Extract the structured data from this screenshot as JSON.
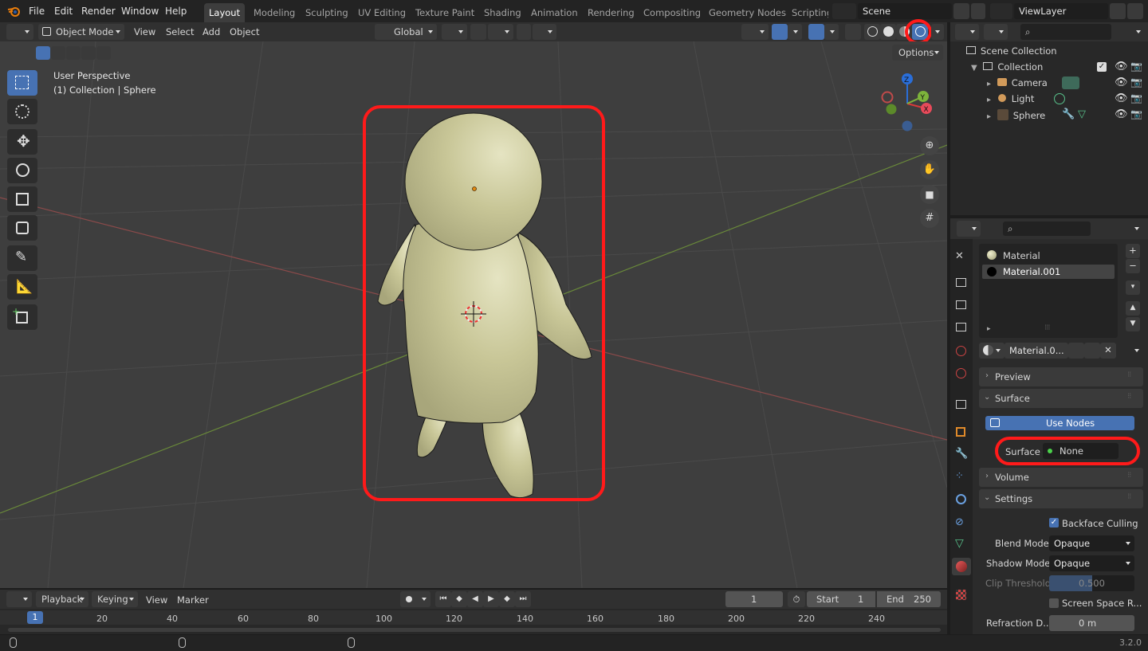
{
  "menubar": {
    "items": [
      "File",
      "Edit",
      "Render",
      "Window",
      "Help"
    ]
  },
  "workspaces": {
    "tabs": [
      "Layout",
      "Modeling",
      "Sculpting",
      "UV Editing",
      "Texture Paint",
      "Shading",
      "Animation",
      "Rendering",
      "Compositing",
      "Geometry Nodes",
      "Scripting"
    ],
    "active": "Layout"
  },
  "scene": {
    "name": "Scene"
  },
  "view_layer": {
    "name": "ViewLayer"
  },
  "viewport_header": {
    "mode": "Object Mode",
    "menus": [
      "View",
      "Select",
      "Add",
      "Object"
    ],
    "transform_orientation": "Global",
    "options_label": "Options"
  },
  "viewport": {
    "perspective_label": "User Perspective",
    "collection_label": "(1) Collection | Sphere",
    "gizmo_axes": {
      "x": "X",
      "y": "Y",
      "z": "Z"
    }
  },
  "outliner": {
    "root": "Scene Collection",
    "collection": "Collection",
    "objects": [
      {
        "name": "Camera",
        "icon": "camera-icon"
      },
      {
        "name": "Light",
        "icon": "light-icon"
      },
      {
        "name": "Sphere",
        "icon": "mesh-icon"
      }
    ]
  },
  "properties": {
    "material_slots": [
      "Material",
      "Material.001"
    ],
    "selected_slot": "Material.001",
    "material_field": "Material.0...",
    "panels": {
      "preview": "Preview",
      "surface": "Surface",
      "volume": "Volume",
      "settings": "Settings"
    },
    "use_nodes_label": "Use Nodes",
    "surface_label": "Surface",
    "surface_value": "None",
    "backface_culling": {
      "label": "Backface Culling",
      "checked": true
    },
    "blend_mode": {
      "label": "Blend Mode",
      "value": "Opaque"
    },
    "shadow_mode": {
      "label": "Shadow Mode",
      "value": "Opaque"
    },
    "clip_threshold": {
      "label": "Clip Threshold",
      "value": "0.500"
    },
    "screen_space": {
      "label": "Screen Space R...",
      "checked": false
    },
    "refraction": {
      "label": "Refraction D...",
      "value": "0 m"
    }
  },
  "timeline": {
    "menus": [
      "Playback",
      "Keying",
      "View",
      "Marker"
    ],
    "current_frame": "1",
    "start_label": "Start",
    "start": "1",
    "end_label": "End",
    "end": "250",
    "ruler_ticks": [
      "1",
      "20",
      "40",
      "60",
      "80",
      "100",
      "120",
      "140",
      "160",
      "180",
      "200",
      "220",
      "240"
    ]
  },
  "statusbar": {
    "version": "3.2.0"
  },
  "colors": {
    "accent": "#4772b3",
    "highlight_ring": "#ff1a1a",
    "mesh": "#c9c79a",
    "background": "#3d3d3d"
  }
}
